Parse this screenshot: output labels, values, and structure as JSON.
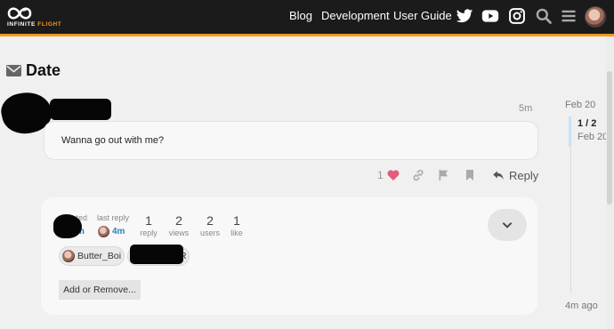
{
  "header": {
    "logo_text_1": "INFINITE ",
    "logo_text_2": "FLIGHT",
    "nav": [
      "Blog",
      "Development",
      "User Guide"
    ],
    "icons": [
      "twitter-icon",
      "youtube-icon",
      "instagram-icon",
      "search-icon",
      "menu-icon"
    ]
  },
  "topic": {
    "title": "Date"
  },
  "post": {
    "time": "5m",
    "text": "Wanna go out with me?",
    "like_count": "1",
    "reply_label": "Reply"
  },
  "topic_map": {
    "created_label": "created",
    "created_value": "m",
    "last_reply_label": "last reply",
    "last_reply_value": "4m",
    "stats": [
      {
        "value": "1",
        "label": "reply"
      },
      {
        "value": "2",
        "label": "views"
      },
      {
        "value": "2",
        "label": "users"
      },
      {
        "value": "1",
        "label": "like"
      }
    ],
    "participants": [
      "Butter_Boi",
      "R"
    ],
    "add_remove_label": "Add or Remove..."
  },
  "timeline": {
    "top_date": "Feb 20",
    "position": "1 / 2",
    "position_date": "Feb 20",
    "bottom": "4m ago"
  },
  "colors": {
    "accent": "#f39a1d",
    "like_heart": "#e45c7a",
    "link_blue": "#2a84b8"
  }
}
